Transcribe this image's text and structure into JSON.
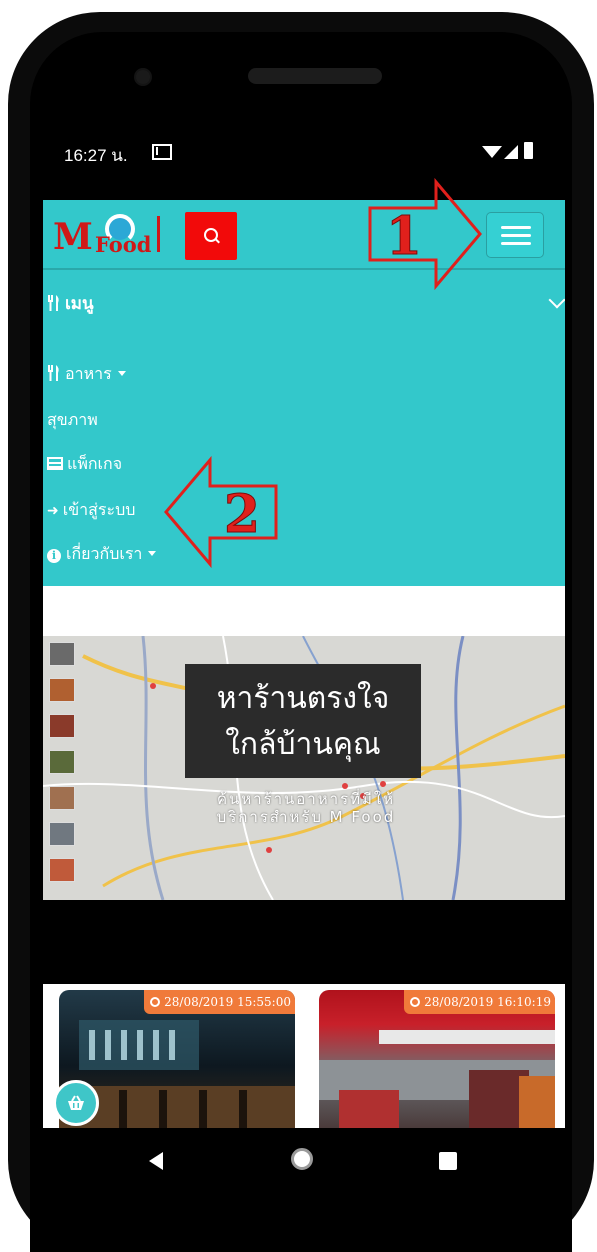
{
  "status_bar": {
    "time": "16:27 น."
  },
  "header": {
    "logo_m": "M",
    "logo_food": "Food"
  },
  "menu": {
    "header": "เมนู",
    "items": [
      {
        "label": "อาหาร",
        "has_caret": true
      },
      {
        "label": "สุขภาพ"
      },
      {
        "label": "แพ็กเกจ"
      },
      {
        "label": "เข้าสู่ระบบ"
      },
      {
        "label": "เกี่ยวกับเรา",
        "has_caret": true
      }
    ]
  },
  "hero": {
    "title_line1": "หาร้านตรงใจ",
    "title_line2": "ใกล้บ้านคุณ",
    "subtitle": "ค้นหาร้านอาหารที่มีให้บริการสำหรับ M Food"
  },
  "cards": [
    {
      "date": "28/08/2019 15:55:00"
    },
    {
      "date": "28/08/2019 16:10:19"
    }
  ],
  "annotations": {
    "step1": "1",
    "step2": "2"
  },
  "colors": {
    "brand_teal": "#33c8cb",
    "brand_red": "#d01818",
    "search_red": "#f20a0a",
    "badge_orange": "#f07a3a"
  }
}
